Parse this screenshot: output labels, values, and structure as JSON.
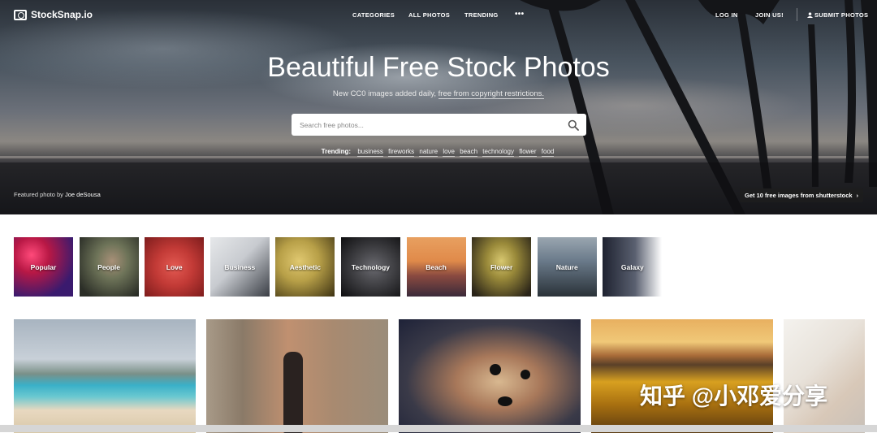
{
  "brand": {
    "name": "StockSnap.io"
  },
  "nav": {
    "categories": "CATEGORIES",
    "all_photos": "ALL PHOTOS",
    "trending": "TRENDING",
    "more": "•••",
    "login": "LOG IN",
    "join": "JOIN US!",
    "submit": "SUBMIT PHOTOS"
  },
  "hero": {
    "title": "Beautiful Free Stock Photos",
    "subtitle_prefix": "New CC0 images added daily, ",
    "subtitle_link": "free from copyright restrictions.",
    "search_placeholder": "Search free photos...",
    "trending_label": "Trending:",
    "trending_tags": [
      "business",
      "fireworks",
      "nature",
      "love",
      "beach",
      "technology",
      "flower",
      "food"
    ],
    "featured_prefix": "Featured photo by ",
    "featured_author": "Joe deSousa",
    "promo": "Get 10 free images from shutterstock"
  },
  "categories": [
    {
      "label": "Popular",
      "colors": [
        "#b81845",
        "#3a1a6e"
      ]
    },
    {
      "label": "People",
      "colors": [
        "#6d7358",
        "#2b2e27"
      ]
    },
    {
      "label": "Love",
      "colors": [
        "#c23a36",
        "#7d1c1c"
      ]
    },
    {
      "label": "Business",
      "colors": [
        "#c8cbd0",
        "#3a3e45"
      ]
    },
    {
      "label": "Aesthetic",
      "colors": [
        "#b8a048",
        "#3d3212"
      ]
    },
    {
      "label": "Technology",
      "colors": [
        "#444448",
        "#0e0e10"
      ]
    },
    {
      "label": "Beach",
      "colors": [
        "#e08a4a",
        "#3a2a3a"
      ]
    },
    {
      "label": "Flower",
      "colors": [
        "#9a8a3a",
        "#2a2418"
      ]
    },
    {
      "label": "Nature",
      "colors": [
        "#6a7a8a",
        "#2a3238"
      ]
    },
    {
      "label": "Galaxy",
      "colors": [
        "#5a6070",
        "#1e2230"
      ]
    }
  ],
  "watermark": "知乎 @小邓爱分享"
}
